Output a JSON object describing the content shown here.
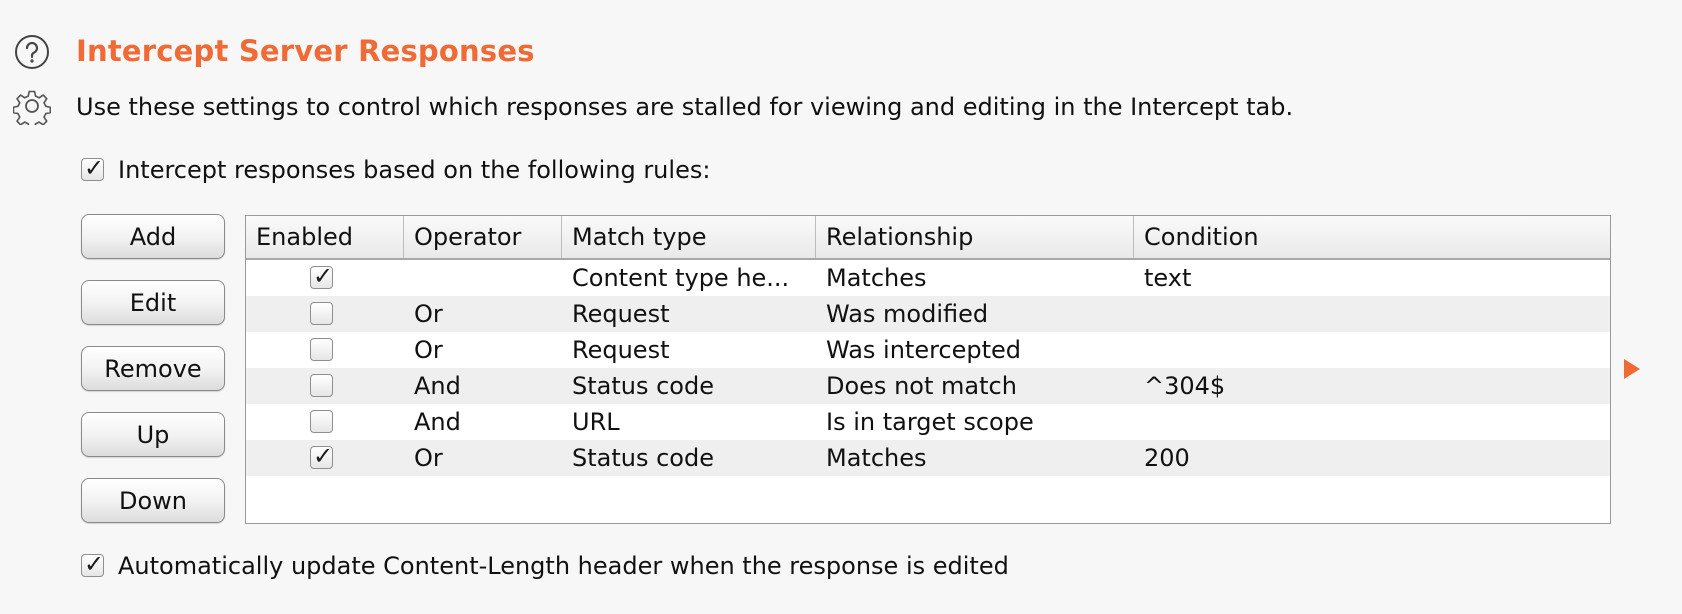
{
  "header": {
    "title": "Intercept Server Responses",
    "description": "Use these settings to control which responses are stalled for viewing and editing in the Intercept tab.",
    "help_icon": "question-circle-icon",
    "settings_icon": "gear-icon",
    "accent_color": "#f06a35"
  },
  "intercept_option": {
    "label": "Intercept responses based on the following rules:",
    "checked": true
  },
  "buttons": {
    "add": "Add",
    "edit": "Edit",
    "remove": "Remove",
    "up": "Up",
    "down": "Down"
  },
  "table": {
    "columns": {
      "enabled": "Enabled",
      "operator": "Operator",
      "match_type": "Match type",
      "relationship": "Relationship",
      "condition": "Condition"
    },
    "rows": [
      {
        "enabled": true,
        "operator": "",
        "match_type": "Content type he...",
        "relationship": "Matches",
        "condition": "text"
      },
      {
        "enabled": false,
        "operator": "Or",
        "match_type": "Request",
        "relationship": "Was modified",
        "condition": ""
      },
      {
        "enabled": false,
        "operator": "Or",
        "match_type": "Request",
        "relationship": "Was intercepted",
        "condition": ""
      },
      {
        "enabled": false,
        "operator": "And",
        "match_type": "Status code",
        "relationship": "Does not match",
        "condition": "^304$"
      },
      {
        "enabled": false,
        "operator": "And",
        "match_type": "URL",
        "relationship": "Is in target scope",
        "condition": ""
      },
      {
        "enabled": true,
        "operator": "Or",
        "match_type": "Status code",
        "relationship": "Matches",
        "condition": "200"
      }
    ]
  },
  "auto_update_option": {
    "label": "Automatically update Content-Length header when the response is edited",
    "checked": true
  },
  "expand_icon": "triangle-right-icon"
}
